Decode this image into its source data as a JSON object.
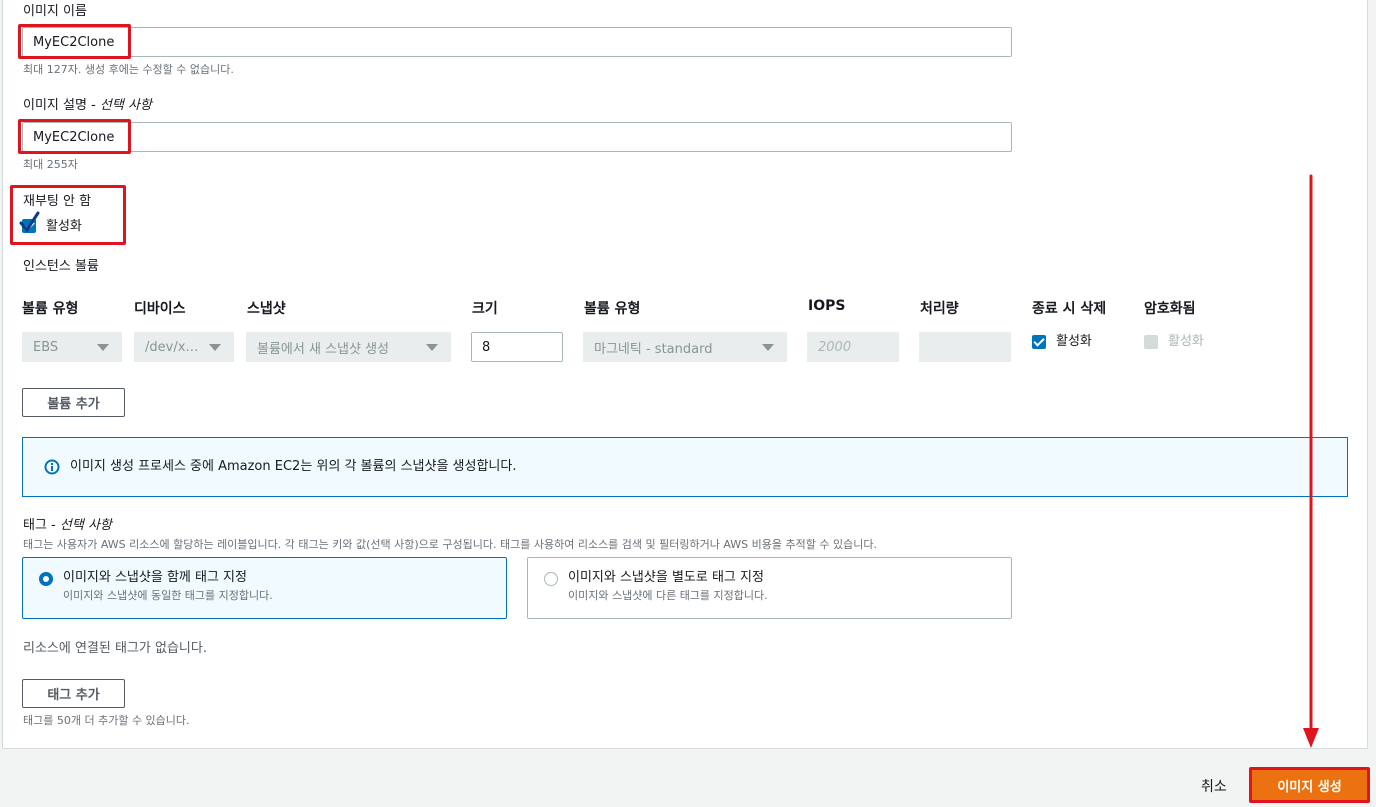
{
  "image_name": {
    "label": "이미지 이름",
    "value": "MyEC2Clone",
    "hint": "최대 127자. 생성 후에는 수정할 수 없습니다."
  },
  "image_description": {
    "label": "이미지 설명 - ",
    "label_optional": "선택 사항",
    "value": "MyEC2Clone",
    "hint": "최대 255자"
  },
  "no_reboot": {
    "label": "재부팅 안 함",
    "checkbox_label": "활성화",
    "checked": true
  },
  "instance_volumes": {
    "section_label": "인스턴스 볼륨",
    "headers": [
      "볼륨 유형",
      "디바이스",
      "스냅샷",
      "크기",
      "볼륨 유형",
      "IOPS",
      "처리량",
      "종료 시 삭제",
      "암호화됨"
    ],
    "row": {
      "volume_type": "EBS",
      "device": "/dev/x…",
      "snapshot": "볼륨에서 새 스냅샷 생성",
      "size": "8",
      "ebs_type": "마그네틱 - standard",
      "iops_placeholder": "2000",
      "throughput": "",
      "delete_on_termination": "활성화",
      "encrypted": "활성화"
    },
    "add_volume_button": "볼륨 추가"
  },
  "info_alert": "이미지 생성 프로세스 중에 Amazon EC2는 위의 각 볼륨의 스냅샷을 생성합니다.",
  "tags": {
    "title": "태그 - ",
    "title_optional": "선택 사항",
    "description": "태그는 사용자가 AWS 리소스에 할당하는 레이블입니다. 각 태그는 키와 값(선택 사항)으로 구성됩니다. 태그를 사용하여 리소스를 검색 및 필터링하거나 AWS 비용을 추적할 수 있습니다.",
    "options": [
      {
        "title": "이미지와 스냅샷을 함께 태그 지정",
        "desc": "이미지와 스냅샷에 동일한 태그를 지정합니다.",
        "selected": true
      },
      {
        "title": "이미지와 스냅샷을 별도로 태그 지정",
        "desc": "이미지와 스냅샷에 다른 태그를 지정합니다.",
        "selected": false
      }
    ],
    "empty_text": "리소스에 연결된 태그가 없습니다.",
    "add_tag_button": "태그 추가",
    "remaining_hint": "태그를 50개 더 추가할 수 있습니다."
  },
  "footer": {
    "cancel": "취소",
    "create": "이미지 생성"
  },
  "colors": {
    "accent": "#0073bb",
    "primary_button": "#ec7211",
    "annotation": "#e0141e"
  }
}
